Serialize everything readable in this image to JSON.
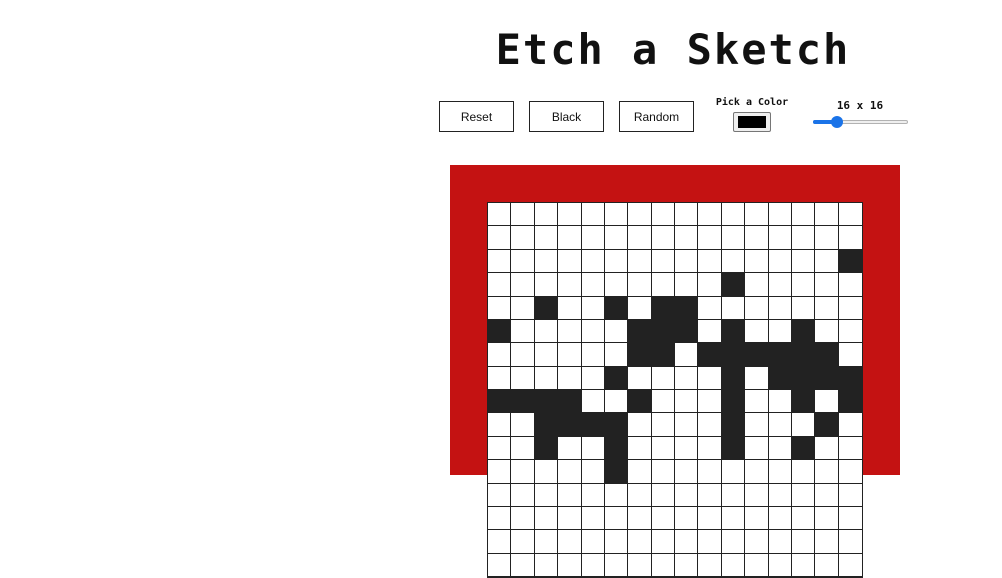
{
  "title": "Etch a Sketch",
  "controls": {
    "reset_label": "Reset",
    "black_label": "Black",
    "random_label": "Random",
    "picker_label": "Pick a Color",
    "picker_value": "#000000",
    "size_label": "16 x 16",
    "size_value": 16,
    "size_fraction": 0.25
  },
  "colors": {
    "frame": "#c41212",
    "ink": "#222222",
    "accent": "#1a73e8"
  },
  "grid": {
    "size": 16,
    "rows": [
      "0000000000000000",
      "0000000000000000",
      "0000000000000001",
      "0000000000100000",
      "0010010110000000",
      "1000001110100100",
      "0000001101111110",
      "0000010000101111",
      "1111001000100101",
      "0011110000100010",
      "0010010000100100",
      "0000010000000000",
      "0000000000000000",
      "0000000000000000",
      "0000000000000000",
      "0000000000000000"
    ]
  }
}
